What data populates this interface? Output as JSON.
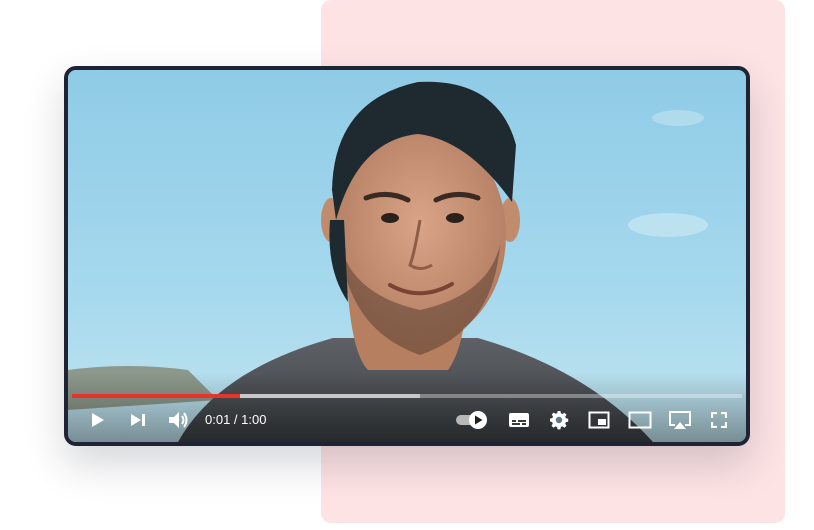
{
  "player": {
    "time_current": "0:01",
    "time_separator": " / ",
    "time_total": "1:00",
    "progress_played": 0.25,
    "progress_buffered": 0.52,
    "autoplay_on": true
  },
  "controls": {
    "left": [
      "play-icon",
      "next-icon",
      "volume-icon"
    ],
    "right": [
      "autoplay-toggle-icon",
      "subtitles-icon",
      "settings-gear-icon",
      "miniplayer-icon",
      "theater-mode-icon",
      "cast-icon",
      "fullscreen-icon"
    ]
  },
  "colors": {
    "accent": "#e8322a",
    "frame": "#1e2433",
    "backdrop": "#fde3e4",
    "sky": "#9fd3ea"
  }
}
